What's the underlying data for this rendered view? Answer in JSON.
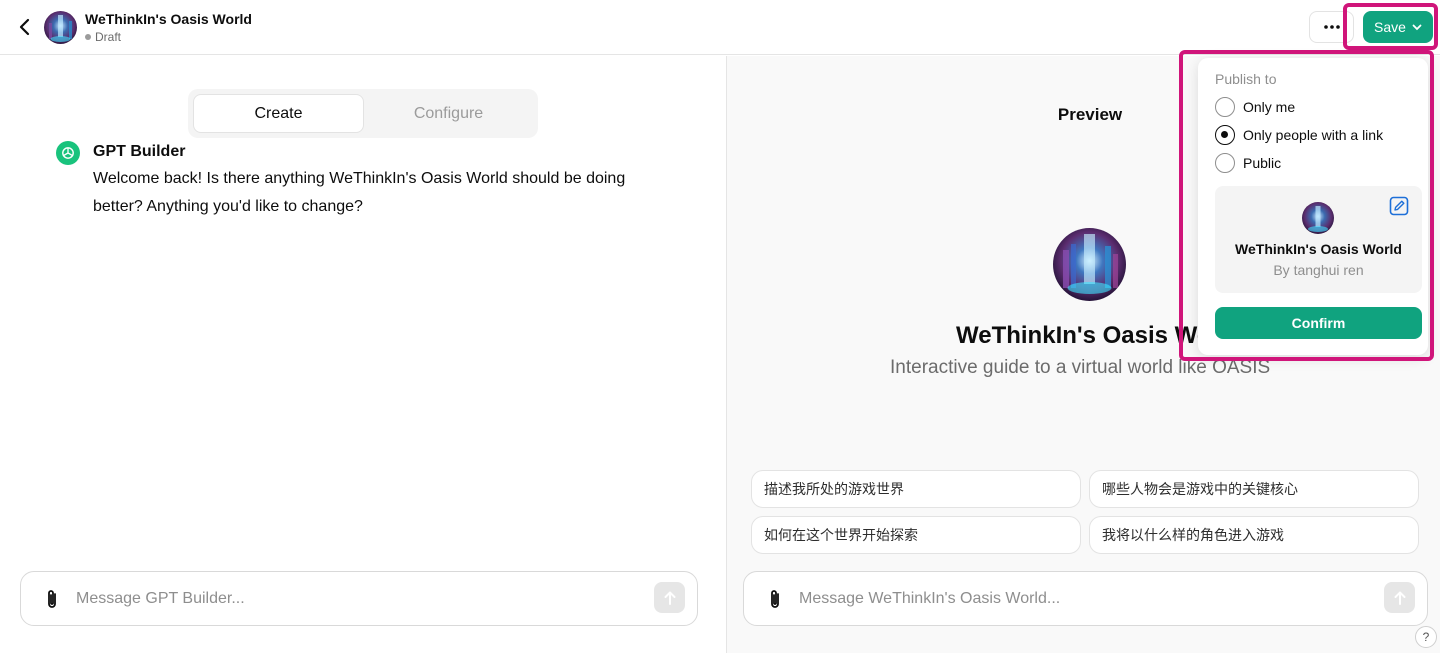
{
  "header": {
    "gpt_name": "WeThinkIn's Oasis World",
    "status": "Draft",
    "save_label": "Save"
  },
  "left": {
    "tabs": [
      {
        "label": "Create",
        "active": true
      },
      {
        "label": "Configure",
        "active": false
      }
    ],
    "builder_name": "GPT Builder",
    "builder_message": "Welcome back! Is there anything WeThinkIn's Oasis World should be doing better? Anything you'd like to change?",
    "composer_placeholder": "Message GPT Builder..."
  },
  "preview": {
    "title": "Preview",
    "gpt_name": "WeThinkIn's Oasis World",
    "description": "Interactive guide to a virtual world like OASIS",
    "starters": [
      "描述我所处的游戏世界",
      "哪些人物会是游戏中的关键核心",
      "如何在这个世界开始探索",
      "我将以什么样的角色进入游戏"
    ],
    "composer_placeholder": "Message WeThinkIn's Oasis World..."
  },
  "publish": {
    "label": "Publish to",
    "options": [
      {
        "label": "Only me",
        "checked": false
      },
      {
        "label": "Only people with a link",
        "checked": true
      },
      {
        "label": "Public",
        "checked": false
      }
    ],
    "card_name": "WeThinkIn's Oasis World",
    "card_author": "By tanghui ren",
    "confirm_label": "Confirm"
  },
  "help_label": "?",
  "colors": {
    "accent": "#10a37f",
    "highlight": "#d0157a"
  },
  "icons": [
    "back-arrow-icon",
    "more-icon",
    "chevron-down-icon",
    "openai-logo-icon",
    "paperclip-icon",
    "arrow-up-icon",
    "edit-icon"
  ]
}
